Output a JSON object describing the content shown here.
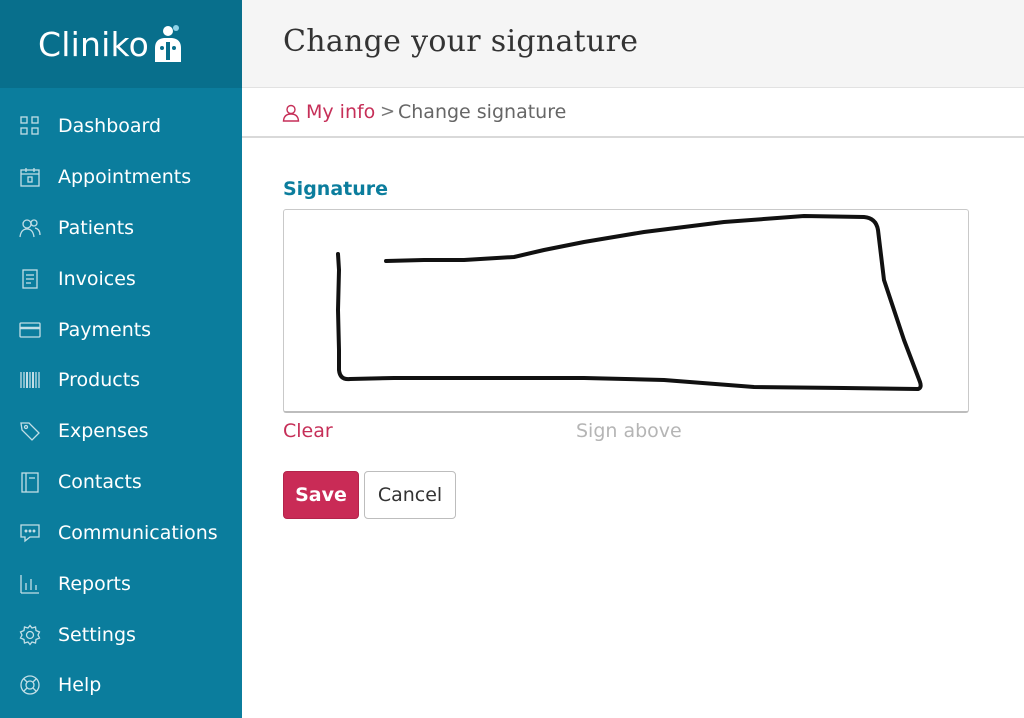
{
  "brand": {
    "name": "Cliniko"
  },
  "sidebar": {
    "items": [
      {
        "label": "Dashboard",
        "icon": "dashboard-icon"
      },
      {
        "label": "Appointments",
        "icon": "calendar-icon"
      },
      {
        "label": "Patients",
        "icon": "people-icon"
      },
      {
        "label": "Invoices",
        "icon": "invoice-icon"
      },
      {
        "label": "Payments",
        "icon": "credit-card-icon"
      },
      {
        "label": "Products",
        "icon": "barcode-icon"
      },
      {
        "label": "Expenses",
        "icon": "tag-icon"
      },
      {
        "label": "Contacts",
        "icon": "address-book-icon"
      },
      {
        "label": "Communications",
        "icon": "chat-icon"
      },
      {
        "label": "Reports",
        "icon": "bar-chart-icon"
      },
      {
        "label": "Settings",
        "icon": "gear-icon"
      },
      {
        "label": "Help",
        "icon": "lifebuoy-icon"
      }
    ]
  },
  "header": {
    "title": "Change your signature"
  },
  "breadcrumb": {
    "parent": "My info",
    "separator": ">",
    "current": "Change signature"
  },
  "form": {
    "field_label": "Signature",
    "clear_label": "Clear",
    "hint": "Sign above",
    "save_label": "Save",
    "cancel_label": "Cancel"
  },
  "colors": {
    "sidebar": "#0b7d9d",
    "sidebar_brand": "#086f8c",
    "accent": "#c92b56",
    "label": "#0b7d9d"
  }
}
